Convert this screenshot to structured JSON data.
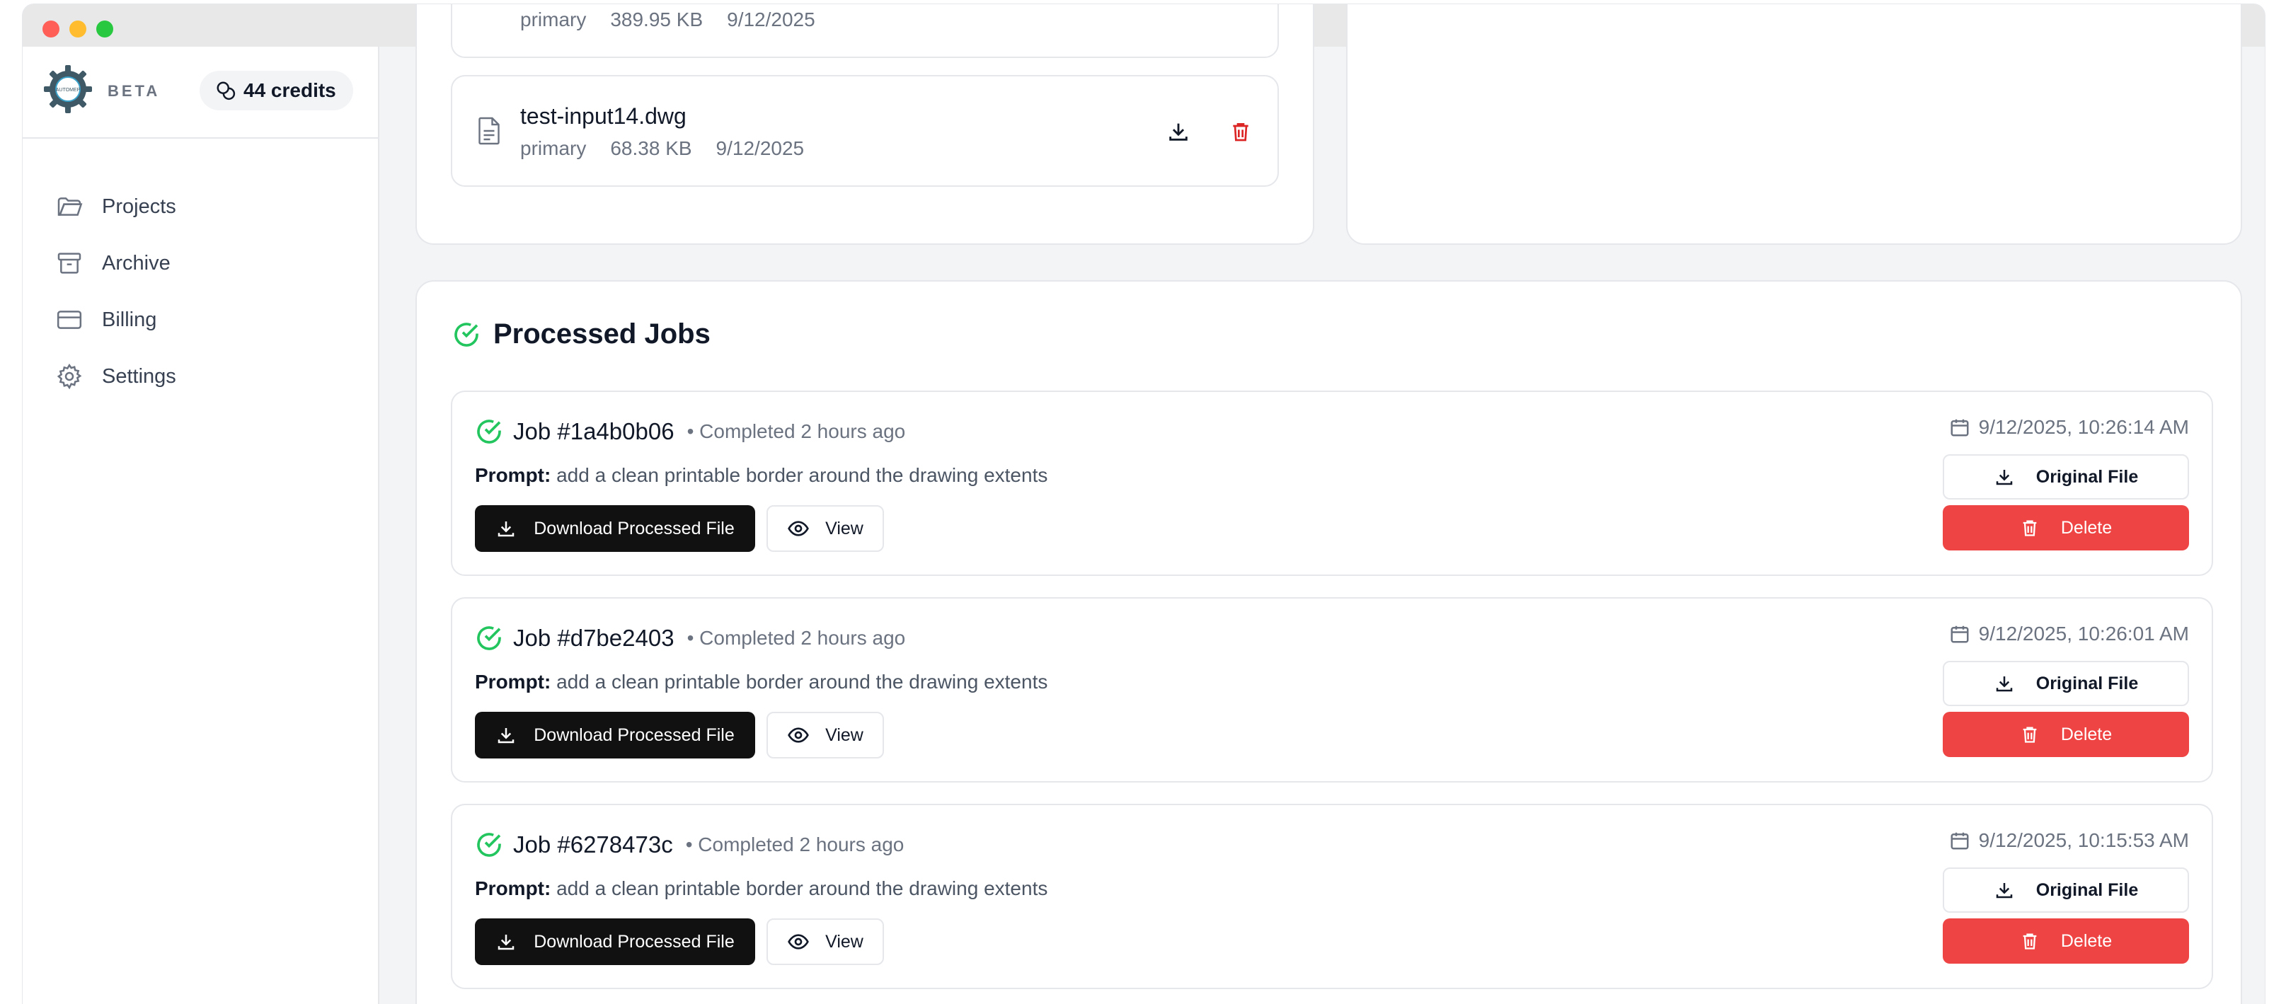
{
  "window": {
    "controls": [
      "close",
      "minimize",
      "maximize"
    ]
  },
  "sidebar": {
    "logo_text": "AUTOMEP",
    "beta_label": "BETA",
    "credits_label": "44 credits",
    "items": [
      {
        "label": "Projects",
        "icon": "folder-icon"
      },
      {
        "label": "Archive",
        "icon": "archive-icon"
      },
      {
        "label": "Billing",
        "icon": "credit-card-icon"
      },
      {
        "label": "Settings",
        "icon": "gear-icon"
      }
    ]
  },
  "files": {
    "partial_row": {
      "type": "primary",
      "size": "389.95 KB",
      "date": "9/12/2025"
    },
    "row": {
      "name": "test-input14.dwg",
      "type": "primary",
      "size": "68.38 KB",
      "date": "9/12/2025"
    }
  },
  "processed_jobs": {
    "title": "Processed Jobs",
    "prompt_label": "Prompt:",
    "download_label": "Download Processed File",
    "view_label": "View",
    "original_label": "Original File",
    "delete_label": "Delete",
    "jobs": [
      {
        "title": "Job #1a4b0b06",
        "status": "• Completed 2 hours ago",
        "prompt": "add a clean printable border around the drawing extents",
        "date": "9/12/2025, 10:26:14 AM"
      },
      {
        "title": "Job #d7be2403",
        "status": "• Completed 2 hours ago",
        "prompt": "add a clean printable border around the drawing extents",
        "date": "9/12/2025, 10:26:01 AM"
      },
      {
        "title": "Job #6278473c",
        "status": "• Completed 2 hours ago",
        "prompt": "add a clean printable border around the drawing extents",
        "date": "9/12/2025, 10:15:53 AM"
      }
    ]
  },
  "colors": {
    "accent_success": "#22c55e",
    "danger": "#ef4444",
    "primary_button": "#111111"
  }
}
